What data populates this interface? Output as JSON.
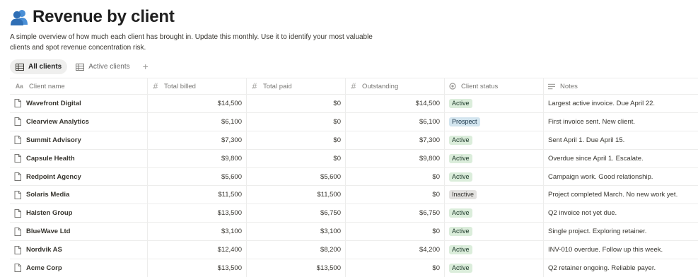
{
  "page": {
    "title": "Revenue by client",
    "description": "A simple overview of how much each client has brought in. Update this monthly. Use it to identify your most valuable clients and spot revenue concentration risk."
  },
  "views": {
    "tabs": [
      {
        "label": "All clients",
        "icon": "table-icon",
        "active": true
      },
      {
        "label": "Active clients",
        "icon": "table-icon",
        "active": false
      }
    ],
    "add_label": "+"
  },
  "table": {
    "columns": [
      {
        "label": "Client name",
        "icon": "text-property-icon"
      },
      {
        "label": "Total billed",
        "icon": "number-property-icon"
      },
      {
        "label": "Total paid",
        "icon": "number-property-icon"
      },
      {
        "label": "Outstanding",
        "icon": "number-property-icon"
      },
      {
        "label": "Client status",
        "icon": "status-property-icon"
      },
      {
        "label": "Notes",
        "icon": "notes-property-icon"
      }
    ],
    "rows": [
      {
        "name": "Wavefront Digital",
        "billed": "$14,500",
        "paid": "$0",
        "outstanding": "$14,500",
        "status": "Active",
        "notes": "Largest active invoice. Due April 22."
      },
      {
        "name": "Clearview Analytics",
        "billed": "$6,100",
        "paid": "$0",
        "outstanding": "$6,100",
        "status": "Prospect",
        "notes": "First invoice sent. New client."
      },
      {
        "name": "Summit Advisory",
        "billed": "$7,300",
        "paid": "$0",
        "outstanding": "$7,300",
        "status": "Active",
        "notes": "Sent April 1. Due April 15."
      },
      {
        "name": "Capsule Health",
        "billed": "$9,800",
        "paid": "$0",
        "outstanding": "$9,800",
        "status": "Active",
        "notes": "Overdue since April 1. Escalate."
      },
      {
        "name": "Redpoint Agency",
        "billed": "$5,600",
        "paid": "$5,600",
        "outstanding": "$0",
        "status": "Active",
        "notes": "Campaign work. Good relationship."
      },
      {
        "name": "Solaris Media",
        "billed": "$11,500",
        "paid": "$11,500",
        "outstanding": "$0",
        "status": "Inactive",
        "notes": "Project completed March. No new work yet."
      },
      {
        "name": "Halsten Group",
        "billed": "$13,500",
        "paid": "$6,750",
        "outstanding": "$6,750",
        "status": "Active",
        "notes": "Q2 invoice not yet due."
      },
      {
        "name": "BlueWave Ltd",
        "billed": "$3,100",
        "paid": "$3,100",
        "outstanding": "$0",
        "status": "Active",
        "notes": "Single project. Exploring retainer."
      },
      {
        "name": "Nordvik AS",
        "billed": "$12,400",
        "paid": "$8,200",
        "outstanding": "$4,200",
        "status": "Active",
        "notes": "INV-010 overdue. Follow up this week."
      },
      {
        "name": "Acme Corp",
        "billed": "$13,500",
        "paid": "$13,500",
        "outstanding": "$0",
        "status": "Active",
        "notes": "Q2 retainer ongoing. Reliable payer."
      }
    ]
  },
  "colors": {
    "status_active_bg": "#dbeddb",
    "status_prospect_bg": "#d3e5ef",
    "status_inactive_bg": "#e3e2e0"
  }
}
